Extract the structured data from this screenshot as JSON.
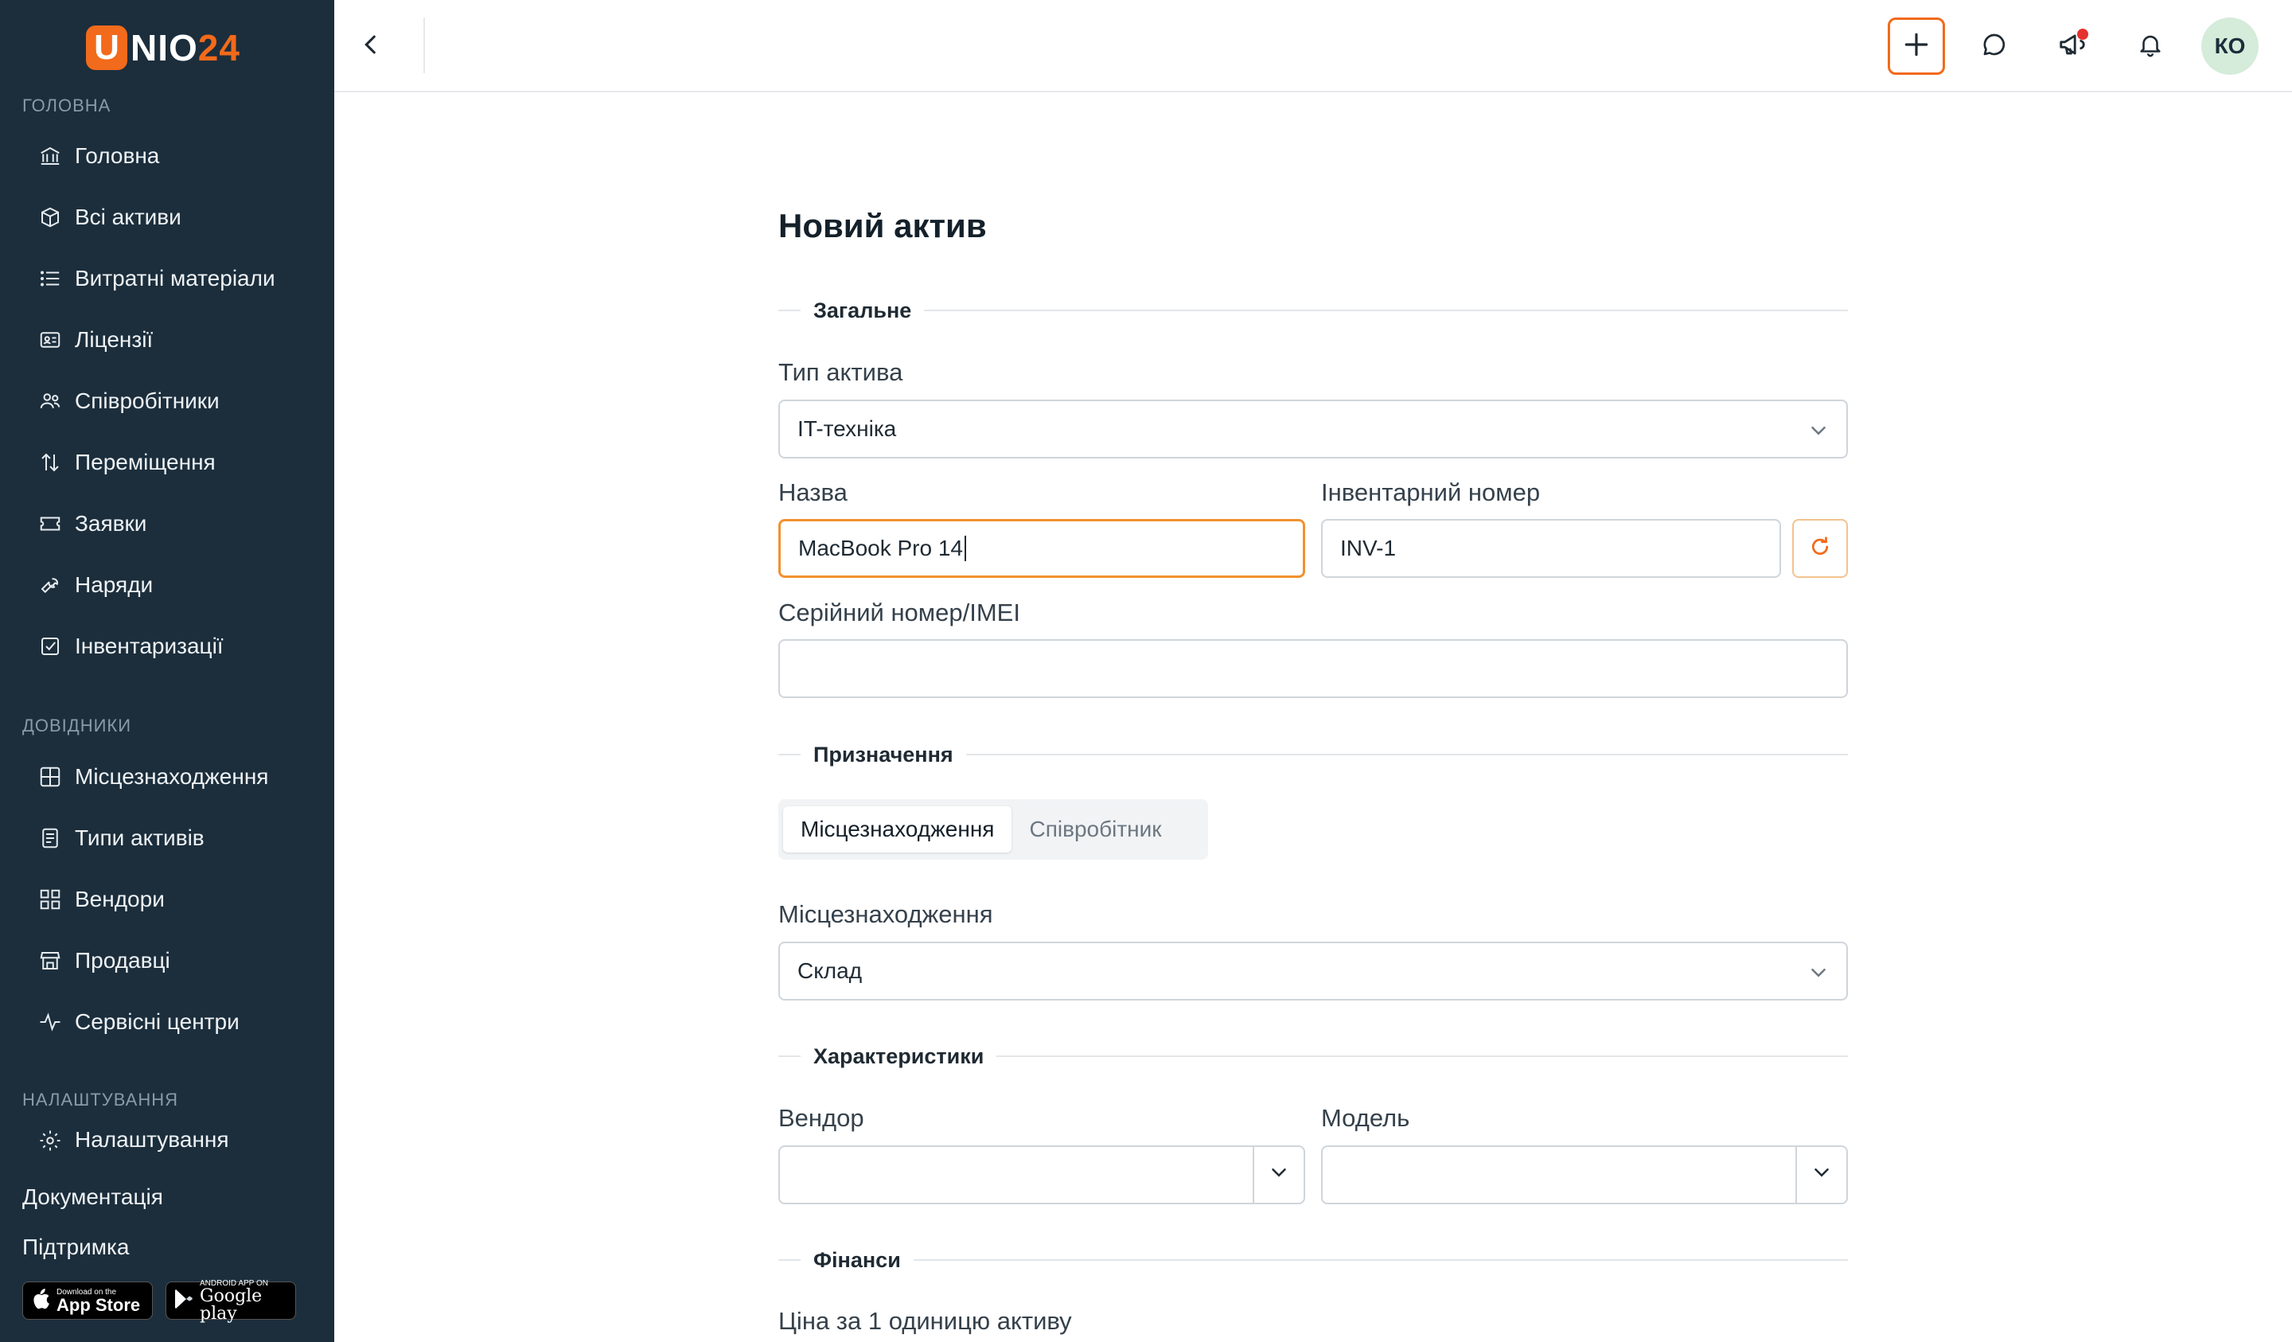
{
  "brand": {
    "logo_letter": "U",
    "logo_main": "NIO",
    "logo_num": "24"
  },
  "sidebar": {
    "sections": {
      "main": "ГОЛОВНА",
      "refs": "ДОВІДНИКИ",
      "settings": "НАЛАШТУВАННЯ"
    },
    "main_items": [
      {
        "label": "Головна",
        "icon": "bank-icon"
      },
      {
        "label": "Всі активи",
        "icon": "box-icon"
      },
      {
        "label": "Витратні матеріали",
        "icon": "list-icon"
      },
      {
        "label": "Ліцензії",
        "icon": "id-card-icon"
      },
      {
        "label": "Співробітники",
        "icon": "users-icon"
      },
      {
        "label": "Переміщення",
        "icon": "arrows-updown-icon"
      },
      {
        "label": "Заявки",
        "icon": "ticket-icon"
      },
      {
        "label": "Наряди",
        "icon": "wrench-icon"
      },
      {
        "label": "Інвентаризації",
        "icon": "checkbox-icon"
      }
    ],
    "ref_items": [
      {
        "label": "Місцезнаходження",
        "icon": "grid-icon"
      },
      {
        "label": "Типи активів",
        "icon": "document-icon"
      },
      {
        "label": "Вендори",
        "icon": "apps-icon"
      },
      {
        "label": "Продавці",
        "icon": "store-icon"
      },
      {
        "label": "Сервісні центри",
        "icon": "pulse-icon"
      }
    ],
    "settings_item": {
      "label": "Налаштування",
      "icon": "gear-icon"
    },
    "docs_link": "Документація",
    "support_link": "Підтримка",
    "app_store": {
      "small": "Download on the",
      "big": "App Store"
    },
    "google_play": {
      "small": "ANDROID APP ON",
      "big": "Google play"
    }
  },
  "header": {
    "avatar_initials": "КО"
  },
  "form": {
    "title": "Новий актив",
    "sections": {
      "general": "Загальне",
      "assignment": "Призначення",
      "specs": "Характеристики",
      "finance": "Фінанси"
    },
    "asset_type": {
      "label": "Тип актива",
      "value": "IT-техніка"
    },
    "name": {
      "label": "Назва",
      "value": "MacBook Pro 14"
    },
    "inventory": {
      "label": "Інвентарний номер",
      "value": "INV-1"
    },
    "serial": {
      "label": "Серійний номер/IMEI",
      "value": ""
    },
    "assign_tabs": {
      "location": "Місцезнаходження",
      "employee": "Співробітник"
    },
    "location": {
      "label": "Місцезнаходження",
      "value": "Склад"
    },
    "vendor": {
      "label": "Вендор",
      "value": ""
    },
    "model": {
      "label": "Модель",
      "value": ""
    },
    "price": {
      "label": "Ціна за 1 одиницю активу"
    }
  },
  "colors": {
    "accent": "#f26a1b",
    "sidebar_bg": "#1c2e3c"
  }
}
